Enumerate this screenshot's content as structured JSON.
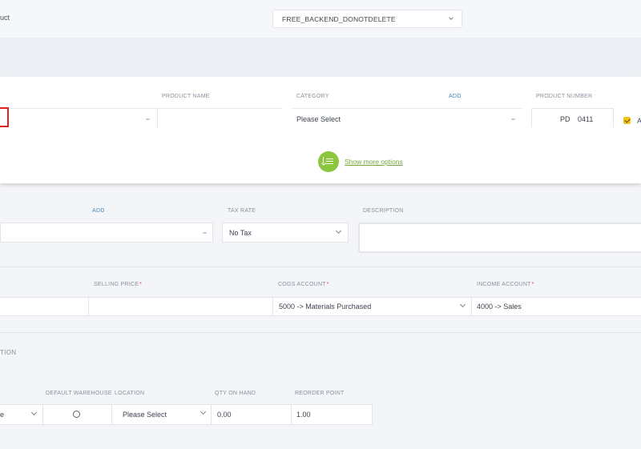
{
  "header": {
    "product_label_fragment": "uct",
    "company_select_value": "FREE_BACKEND_DONOTDELETE"
  },
  "product_panel": {
    "product_name_label": "PRODUCT NAME",
    "category_label": "CATEGORY",
    "category_add": "ADD",
    "category_value": "Please Select",
    "product_number_label": "PRODUCT NUMBER",
    "product_number_prefix": "PD",
    "product_number_value": "0411",
    "checkbox_label_fragment": "A",
    "show_more_options": "Show more options"
  },
  "tax_section": {
    "add_link": "ADD",
    "tax_rate_label": "TAX RATE",
    "tax_rate_value": "No Tax",
    "description_label": "DESCRIPTION"
  },
  "pricing_section": {
    "selling_price_label": "SELLING PRICE",
    "required_mark": "*",
    "cogs_account_label": "COGS ACCOUNT",
    "cogs_account_value": "5000 -> Materials Purchased",
    "income_account_label": "INCOME ACCOUNT",
    "income_account_value": "4000 -> Sales"
  },
  "inventory_section": {
    "title_fragment": "TION",
    "default_warehouse_label": "DEFAULT WAREHOUSE",
    "location_label": "LOCATION",
    "qty_on_hand_label": "QTY ON HAND",
    "reorder_point_label": "REORDER POINT",
    "warehouse_value_fragment": "e",
    "location_value": "Please Select",
    "qty_on_hand_value": "0.00",
    "reorder_point_value": "1.00"
  },
  "colors": {
    "accent_green": "#8cc63f",
    "checkbox_yellow": "#f2c318",
    "error_red": "#e0201c",
    "link_blue": "#3d8ab8"
  }
}
